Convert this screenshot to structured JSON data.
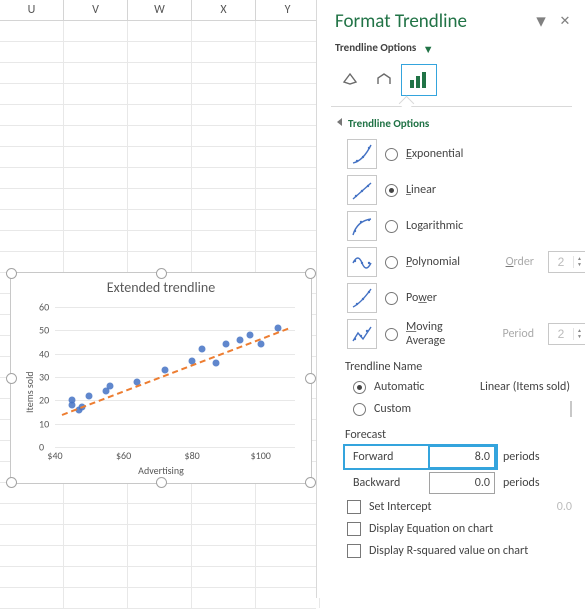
{
  "columns": [
    "U",
    "V",
    "W",
    "X",
    "Y"
  ],
  "chart_data": {
    "type": "scatter",
    "title": "Extended trendline",
    "xlabel": "Advertising",
    "ylabel": "Items sold",
    "xlim": [
      40,
      110
    ],
    "ylim": [
      0,
      60
    ],
    "yticks": [
      0,
      10,
      20,
      30,
      40,
      50,
      60
    ],
    "xticks": [
      "$40",
      "$60",
      "$80",
      "$100"
    ],
    "xtick_vals": [
      40,
      60,
      80,
      100
    ],
    "series": [
      {
        "name": "Items sold",
        "points": [
          {
            "x": 45,
            "y": 18
          },
          {
            "x": 45,
            "y": 20
          },
          {
            "x": 47,
            "y": 16
          },
          {
            "x": 48,
            "y": 17
          },
          {
            "x": 50,
            "y": 22
          },
          {
            "x": 55,
            "y": 24
          },
          {
            "x": 56,
            "y": 26
          },
          {
            "x": 64,
            "y": 28
          },
          {
            "x": 72,
            "y": 33
          },
          {
            "x": 80,
            "y": 37
          },
          {
            "x": 83,
            "y": 42
          },
          {
            "x": 87,
            "y": 36
          },
          {
            "x": 90,
            "y": 44
          },
          {
            "x": 94,
            "y": 46
          },
          {
            "x": 97,
            "y": 48
          },
          {
            "x": 100,
            "y": 44
          },
          {
            "x": 105,
            "y": 51
          }
        ]
      }
    ],
    "trendline": {
      "type": "linear",
      "x0": 42,
      "y0": 14,
      "x1": 108,
      "y1": 51
    }
  },
  "pane": {
    "title": "Format Trendline",
    "subtitle": "Trendline Options",
    "section": "Trendline Options",
    "types": [
      {
        "key": "exponential",
        "label": "Exponential",
        "u": "E",
        "checked": false
      },
      {
        "key": "linear",
        "label": "Linear",
        "u": "L",
        "checked": true
      },
      {
        "key": "logarithmic",
        "label": "Logarithmic",
        "u": "O",
        "checked": false
      },
      {
        "key": "polynomial",
        "label": "Polynomial",
        "u": "P",
        "checked": false,
        "param": "Order",
        "paramU": "O",
        "value": "2",
        "disabled": true
      },
      {
        "key": "power",
        "label": "Power",
        "u": "w",
        "checked": false
      },
      {
        "key": "moving",
        "label": "Moving Average",
        "u": "M",
        "checked": false,
        "param": "Period",
        "paramU": "E",
        "value": "2",
        "disabled": true
      }
    ],
    "name_heading": "Trendline Name",
    "name_mode": {
      "automatic": {
        "label": "Automatic",
        "u": "A",
        "checked": true,
        "value": "Linear (Items sold)"
      },
      "custom": {
        "label": "Custom",
        "u": "C",
        "checked": false,
        "value": ""
      }
    },
    "forecast": {
      "heading": "Forecast",
      "forward": {
        "label": "Forward",
        "u": "F",
        "value": "8.0",
        "unit": "periods"
      },
      "backward": {
        "label": "Backward",
        "u": "B",
        "value": "0.0",
        "unit": "periods"
      }
    },
    "checks": {
      "intercept": {
        "label": "Set Intercept",
        "u": "S",
        "checked": false,
        "value": "0.0"
      },
      "equation": {
        "label": "Display Equation on chart",
        "u": "E",
        "checked": false
      },
      "r2": {
        "label": "Display R-squared value on chart",
        "u": "R",
        "checked": false
      }
    }
  }
}
